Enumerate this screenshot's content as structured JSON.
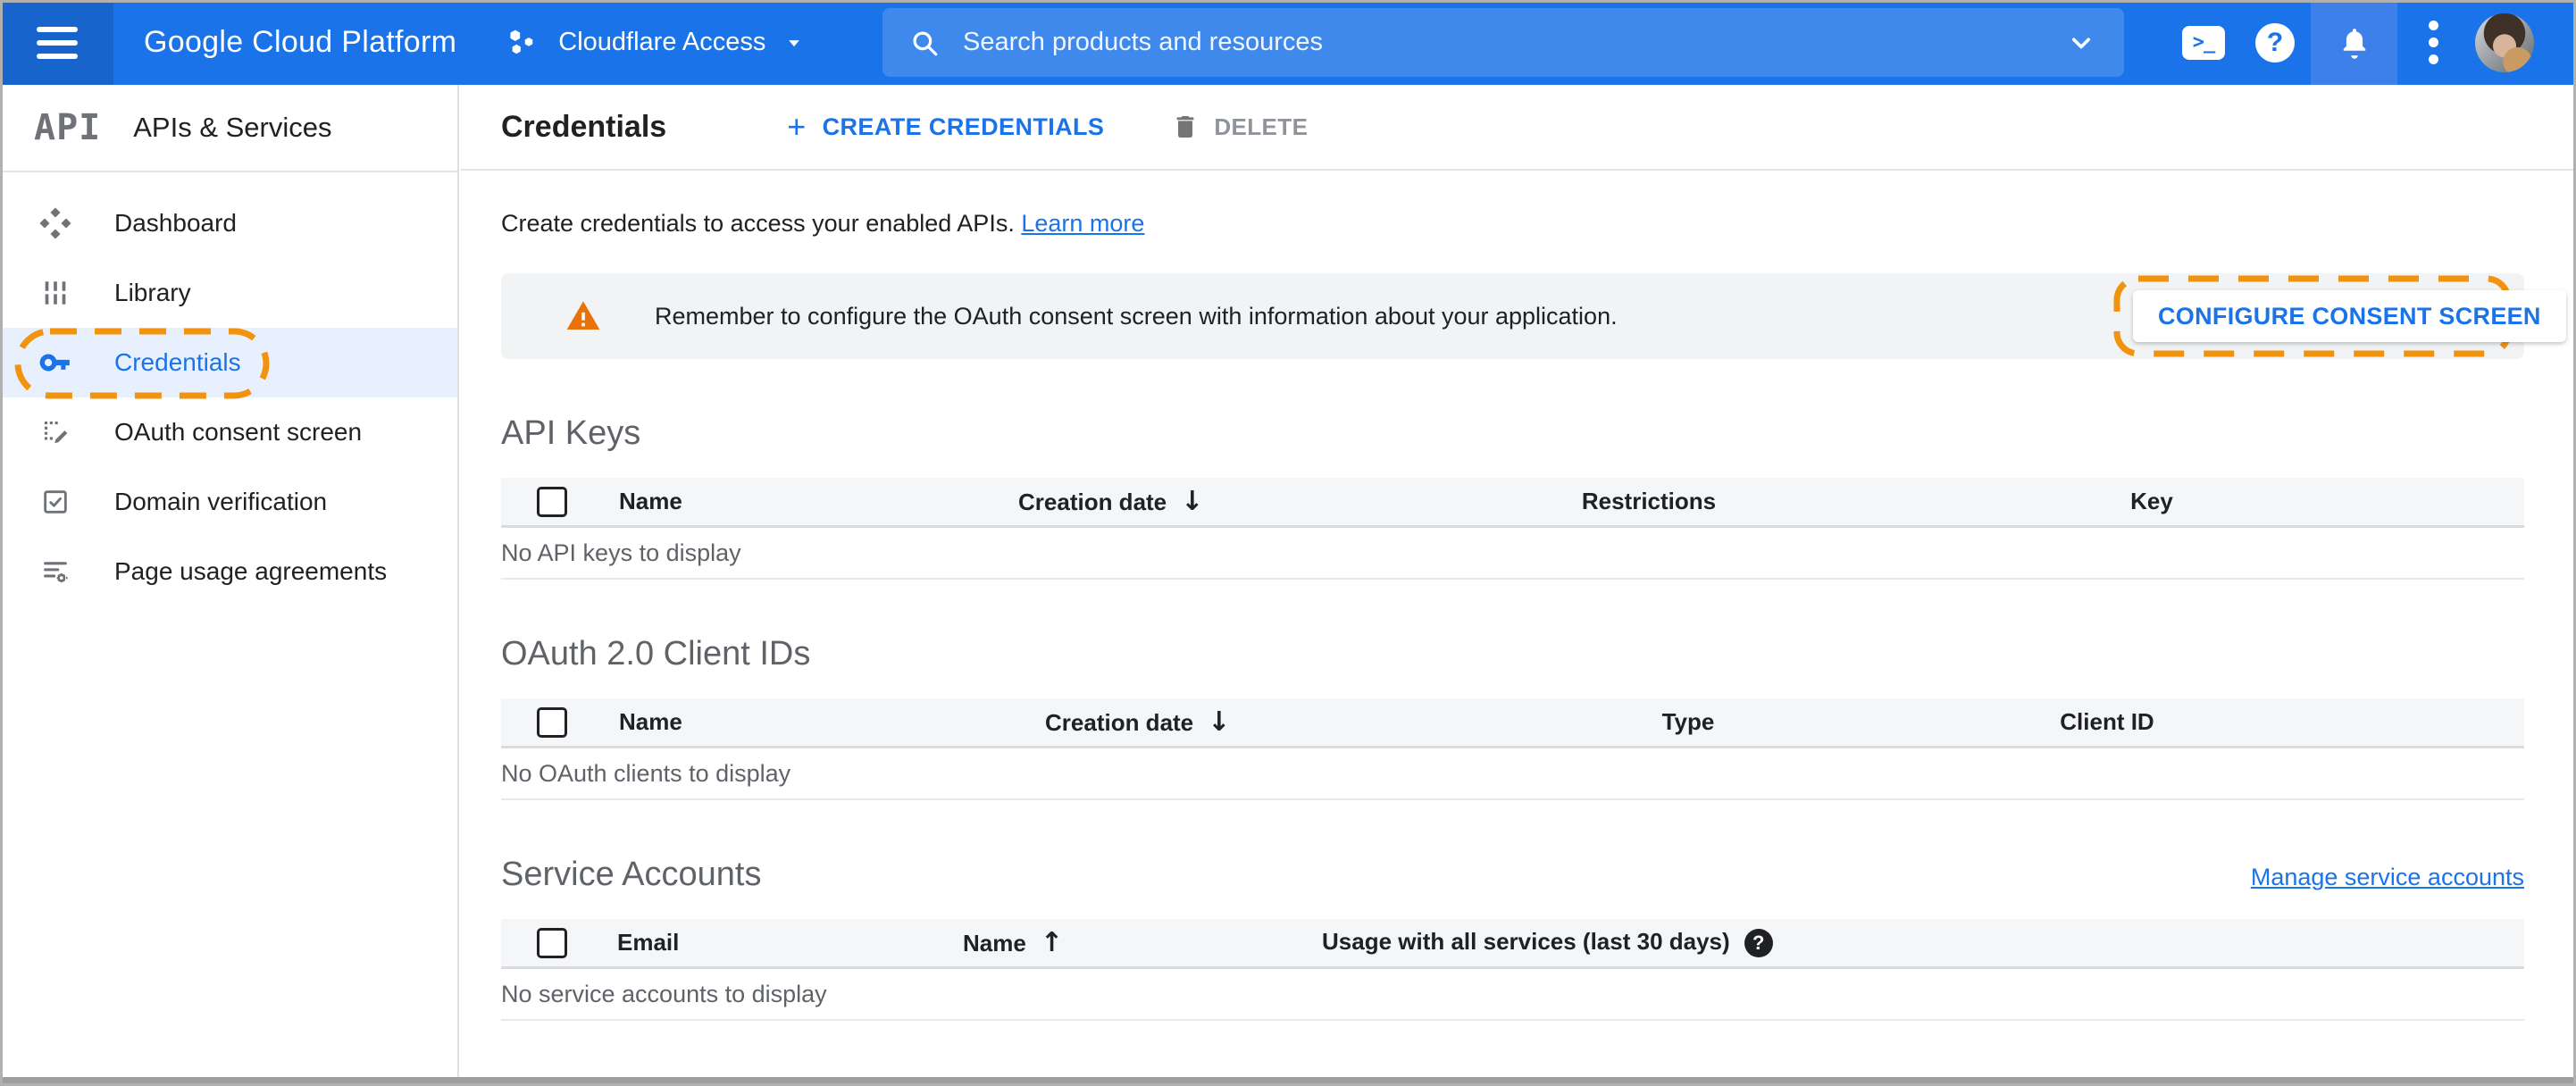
{
  "topbar": {
    "brand": "Google Cloud Platform",
    "project_selector": {
      "label": "Cloudflare Access"
    },
    "search": {
      "placeholder": "Search products and resources"
    },
    "icons": {
      "cloud_shell_glyph": ">_",
      "help_glyph": "?"
    }
  },
  "sidebar": {
    "logo_text": "API",
    "title": "APIs & Services",
    "items": [
      {
        "label": "Dashboard"
      },
      {
        "label": "Library"
      },
      {
        "label": "Credentials",
        "active": true,
        "annotated": true
      },
      {
        "label": "OAuth consent screen"
      },
      {
        "label": "Domain verification"
      },
      {
        "label": "Page usage agreements"
      }
    ]
  },
  "toolbar": {
    "title": "Credentials",
    "create_plus": "+",
    "create_label": "CREATE CREDENTIALS",
    "delete_label": "DELETE"
  },
  "intro": {
    "text": "Create credentials to access your enabled APIs.",
    "link_label": "Learn more"
  },
  "banner": {
    "message": "Remember to configure the OAuth consent screen with information about your application.",
    "button_label": "CONFIGURE CONSENT SCREEN"
  },
  "sections": {
    "api_keys": {
      "title": "API Keys",
      "columns": [
        "Name",
        "Creation date",
        "Restrictions",
        "Key"
      ],
      "sort_glyph": "↓",
      "empty_text": "No API keys to display"
    },
    "oauth_clients": {
      "title": "OAuth 2.0 Client IDs",
      "columns": [
        "Name",
        "Creation date",
        "Type",
        "Client ID"
      ],
      "sort_glyph": "↓",
      "empty_text": "No OAuth clients to display"
    },
    "service_accounts": {
      "title": "Service Accounts",
      "manage_link_label": "Manage service accounts",
      "columns": [
        "Email",
        "Name",
        "Usage with all services (last 30 days)"
      ],
      "sort_glyph": "↑",
      "help_glyph": "?",
      "empty_text": "No service accounts to display"
    }
  },
  "colors": {
    "accent": "#1a73e8",
    "topbar": "#1a73e8",
    "annotation_orange": "#f2930e",
    "warning_orange": "#e8710a",
    "active_item_bg": "#e8f0fe"
  }
}
